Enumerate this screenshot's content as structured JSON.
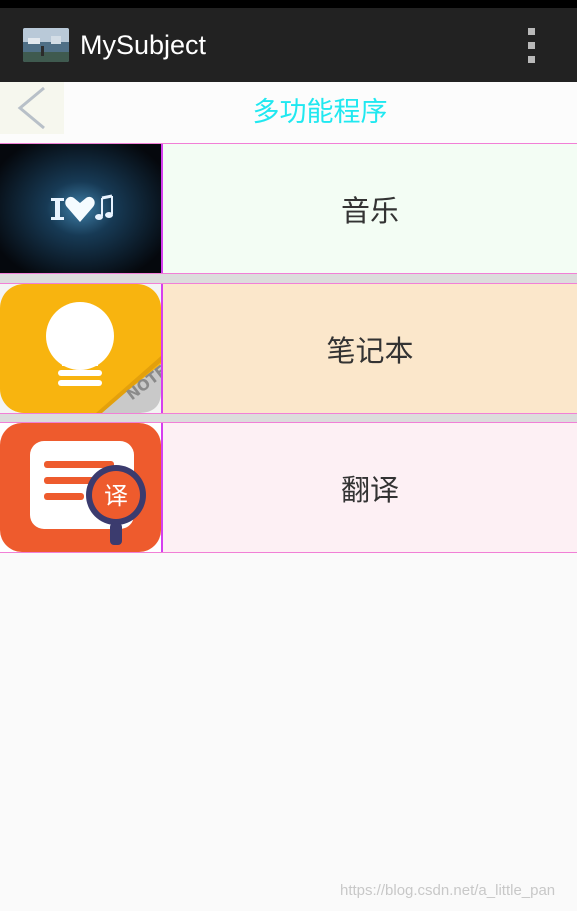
{
  "action_bar": {
    "title": "MySubject",
    "app_icon": "app-thumbnail-icon",
    "menu_icon": "overflow-menu-icon",
    "background": "#222222"
  },
  "header": {
    "title": "多功能程序",
    "back_icon": "chevron-left-icon",
    "title_color": "#20e8f0"
  },
  "features": [
    {
      "label": "音乐",
      "icon": "music-heart-icon",
      "background": "#f3fdf4"
    },
    {
      "label": "笔记本",
      "icon": "notebook-bulb-icon",
      "background": "#fbe7cb"
    },
    {
      "label": "翻译",
      "icon": "translate-icon",
      "background": "#fdf0f4"
    }
  ],
  "translate_icon_glyph": "译",
  "note_badge": "NOTE",
  "watermark": "https://blog.csdn.net/a_little_pan"
}
